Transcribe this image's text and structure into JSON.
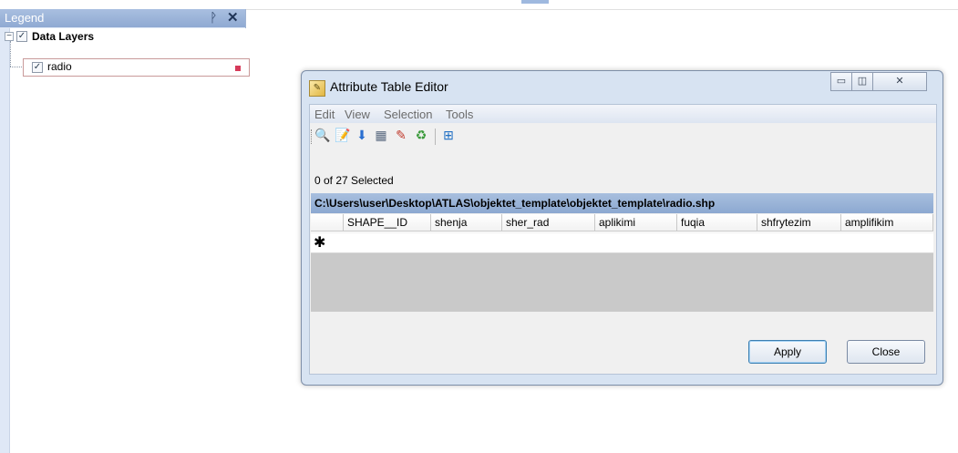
{
  "legend": {
    "title": "Legend",
    "pin_icon": "pin-icon",
    "close_icon": "close-icon",
    "group": {
      "label": "Data Layers",
      "expanded_glyph": "−",
      "checked_glyph": "✓"
    },
    "layer": {
      "label": "radio",
      "checked_glyph": "✓",
      "symbol_color": "#d63a5a"
    }
  },
  "dialog": {
    "title": "Attribute Table Editor",
    "window_buttons": {
      "minimize": "▭",
      "restore": "◫",
      "close": "✕"
    },
    "menu": [
      "Edit",
      "View",
      "Selection",
      "Tools"
    ],
    "toolbar_icons": [
      "zoom-icon",
      "edit-table-icon",
      "move-down-icon",
      "calculator-icon",
      "field-calc-icon",
      "refresh-icon",
      "table-add-icon"
    ],
    "toolbar_glyphs": [
      "🔍",
      "📝",
      "⬇",
      "▦",
      "✎",
      "♻",
      "⊞"
    ],
    "selection_status": "0 of 27 Selected",
    "path": "C:\\Users\\user\\Desktop\\ATLAS\\objektet_template\\objektet_template\\radio.shp",
    "columns": [
      "SHAPE__ID",
      "shenja",
      "sher_rad",
      "aplikimi",
      "fuqia",
      "shfrytezim",
      "amplifikim"
    ],
    "new_row_marker": "✱",
    "apply_label": "Apply",
    "close_label": "Close"
  }
}
